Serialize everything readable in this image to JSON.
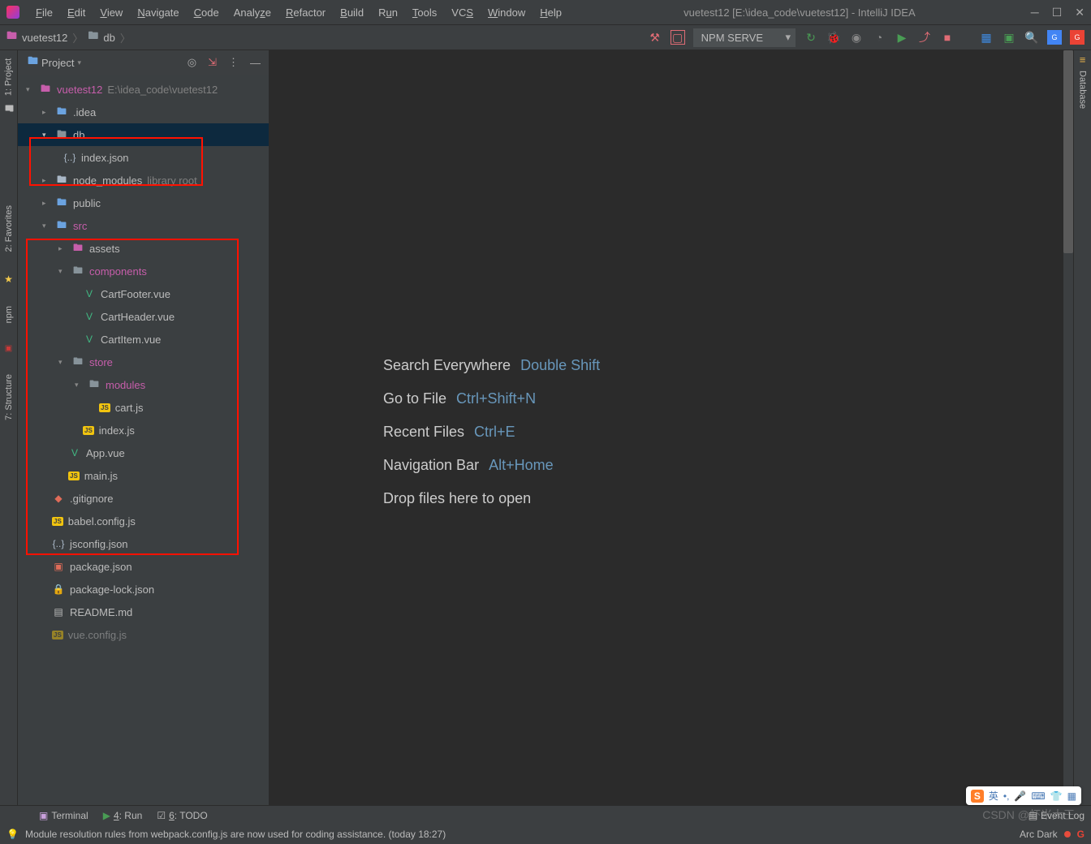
{
  "window": {
    "title": "vuetest12 [E:\\idea_code\\vuetest12] - IntelliJ IDEA"
  },
  "menus": [
    "File",
    "Edit",
    "View",
    "Navigate",
    "Code",
    "Analyze",
    "Refactor",
    "Build",
    "Run",
    "Tools",
    "VCS",
    "Window",
    "Help"
  ],
  "breadcrumb": {
    "root": "vuetest12",
    "child": "db"
  },
  "runConfig": "NPM SERVE",
  "panel": {
    "title": "Project"
  },
  "tree": {
    "root": {
      "name": "vuetest12",
      "path": "E:\\idea_code\\vuetest12"
    },
    "idea": ".idea",
    "db": "db",
    "indexjson": "index.json",
    "nodemodules": "node_modules",
    "libroot": "library root",
    "public": "public",
    "src": "src",
    "assets": "assets",
    "components": "components",
    "cartfooter": "CartFooter.vue",
    "cartheader": "CartHeader.vue",
    "cartitem": "CartItem.vue",
    "store": "store",
    "modules": "modules",
    "cartjs": "cart.js",
    "indexjs": "index.js",
    "appvue": "App.vue",
    "mainjs": "main.js",
    "gitignore": ".gitignore",
    "babelconfig": "babel.config.js",
    "jsconfig": "jsconfig.json",
    "packagejson": "package.json",
    "packagelock": "package-lock.json",
    "readme": "README.md",
    "vueconfig": "vue.config.js"
  },
  "hints": [
    {
      "label": "Search Everywhere",
      "key": "Double Shift"
    },
    {
      "label": "Go to File",
      "key": "Ctrl+Shift+N"
    },
    {
      "label": "Recent Files",
      "key": "Ctrl+E"
    },
    {
      "label": "Navigation Bar",
      "key": "Alt+Home"
    }
  ],
  "dropMsg": "Drop files here to open",
  "bottomTabs": {
    "terminal": "Terminal",
    "run": "4: Run",
    "todo": "6: TODO"
  },
  "eventLog": "Event Log",
  "status": {
    "msg": "Module resolution rules from webpack.config.js are now used for coding assistance. (today 18:27)",
    "theme": "Arc Dark"
  },
  "rightTabs": {
    "database": "Database"
  },
  "leftTabs": {
    "project": "1: Project",
    "favorites": "2: Favorites",
    "npm": "npm",
    "structure": "7: Structure"
  },
  "watermark": "CSDN @虾米大王",
  "ime": "英"
}
